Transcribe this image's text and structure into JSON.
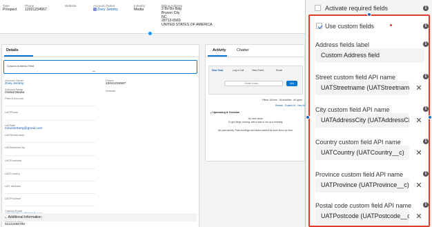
{
  "highlights": {
    "type_label": "Type",
    "type_value": "Prospect",
    "phone_label": "Phone",
    "phone_value": "12021234567",
    "website_label": "Website",
    "owner_label": "Account Owner",
    "owner_value": "Zoey Jemmy",
    "industry_label": "Industry",
    "industry_value": "Media",
    "billing_label": "Billing Address",
    "billing_lines": [
      "3 Bo Bo Bdg",
      "Bryson City",
      "NC",
      "28713-6560",
      "UNITED STATES OF AMERICA"
    ]
  },
  "details": {
    "tab_label": "Details",
    "custom_address_label": "Custom Address Field",
    "fields_left": [
      {
        "label": "Account Owner",
        "value": "Zoey Jemmy",
        "link": true
      },
      {
        "label": "Account Name",
        "value": "Global Media"
      },
      {
        "label": "Parent Account",
        "value": ""
      },
      {
        "label": "UATPhone",
        "value": ""
      },
      {
        "label": "UATMail",
        "value": "mzuckerberg@gmail.com",
        "link": true
      },
      {
        "label": "UATStreetname",
        "value": ""
      },
      {
        "label": "UATAddressCity",
        "value": ""
      },
      {
        "label": "UATPostcode",
        "value": ""
      },
      {
        "label": "UATCountry",
        "value": ""
      },
      {
        "label": "UAT address",
        "value": ""
      },
      {
        "label": "UATProvince",
        "value": ""
      },
      {
        "label": "Custom Email",
        "value": "mzuckerberg@gmail.com",
        "link": true
      },
      {
        "label": "Custom Phone",
        "value": "61122456789"
      }
    ],
    "fields_right": [
      {
        "label": "Phone",
        "value": "12021234567"
      },
      {
        "label": "Website",
        "value": ""
      }
    ],
    "section_additional": "Additional Information"
  },
  "activity": {
    "tab_activity": "Activity",
    "tab_chatter": "Chatter",
    "sub_tabs": [
      "New Task",
      "Log a Call",
      "New Event",
      "Email"
    ],
    "task_placeholder": "Create a task...",
    "add_label": "Add",
    "filters_text": "Filters: All time · All activities · All types",
    "links_text": "Refresh · Expand All · View All",
    "upcoming_label": "Upcoming & Overdue",
    "no_next_steps": "No next steps.",
    "no_next_steps_sub": "To get things moving, add a task or set up a meeting.",
    "no_past_activity": "No past activity. Past meetings and tasks marked as done show up here."
  },
  "settings": {
    "activate_required_label": "Activate required fields",
    "use_custom_label": "Use custom fields",
    "use_custom_checked": true,
    "activate_required_checked": false,
    "fields": [
      {
        "label": "Address fields label",
        "value": "Custom Address field",
        "clearable": false
      },
      {
        "label": "Street custom field API name",
        "value": "UATStreetname (UATStreetname__c)",
        "clearable": true
      },
      {
        "label": "City custom field API name",
        "value": "UATAddressCity (UATAddressCity__c)",
        "clearable": true
      },
      {
        "label": "Country custom field API name",
        "value": "UATCountry (UATCountry__c)",
        "clearable": true
      },
      {
        "label": "Province custom field API name",
        "value": "UATProvince (UATProvince__c)",
        "clearable": true
      },
      {
        "label": "Postal code custom field API name",
        "value": "UATPostcode (UATPostcode__c)",
        "clearable": true
      }
    ],
    "accent_red": "#e03c2a",
    "accent_blue": "#1b66c9"
  }
}
